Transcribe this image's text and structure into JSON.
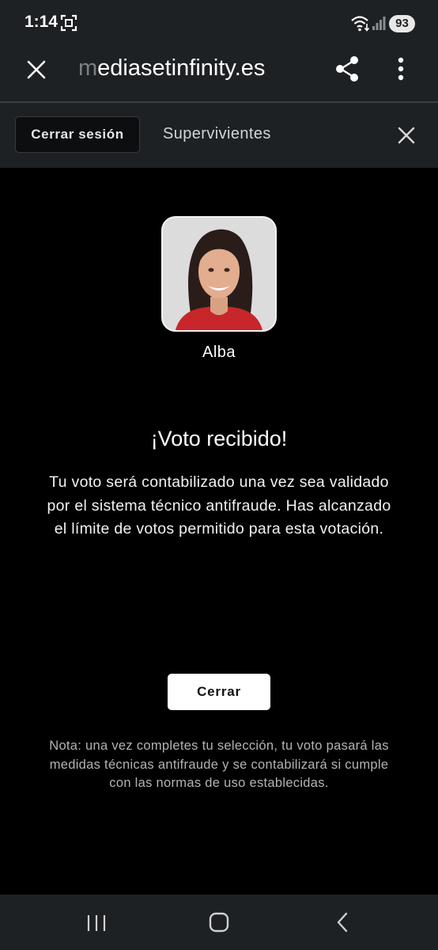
{
  "status_bar": {
    "time": "1:14",
    "battery": "93"
  },
  "browser": {
    "url_faded_prefix": "m",
    "url_rest": "ediasetinfinity.es",
    "close_icon": "close-icon",
    "share_icon": "share-icon",
    "menu_icon": "more-vertical-icon"
  },
  "header": {
    "logout_label": "Cerrar sesión",
    "title": "Supervivientes",
    "close_icon": "close-icon"
  },
  "candidate": {
    "name": "Alba"
  },
  "result": {
    "title": "¡Voto recibido!",
    "message": "Tu voto será contabilizado una vez sea validado por el sistema técnico antifraude. Has alcanzado el límite de votos permitido para esta votación.",
    "close_label": "Cerrar",
    "note": "Nota: una vez completes tu selección, tu voto pasará las medidas técnicas antifraude y se contabilizará si cumple con las normas de uso establecidas."
  },
  "colors": {
    "page_background": "#000000",
    "chrome_background": "#1e2124",
    "button_background": "#ffffff",
    "note_text": "#b3b3b3"
  },
  "nav": {
    "recents_icon": "recents-icon",
    "home_icon": "home-icon",
    "back_icon": "back-icon"
  }
}
